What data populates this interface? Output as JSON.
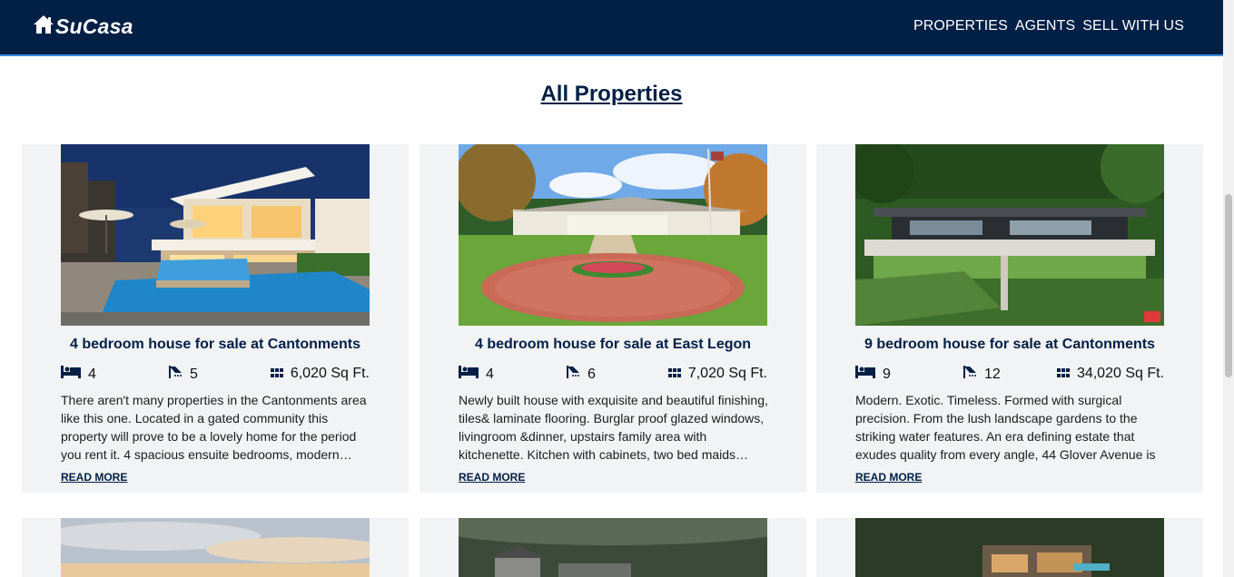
{
  "brand": {
    "name": "SuCasa",
    "icon": "house-icon"
  },
  "nav": {
    "items": [
      {
        "label": "PROPERTIES"
      },
      {
        "label": "AGENTS"
      },
      {
        "label": "SELL WITH US"
      }
    ]
  },
  "main": {
    "title": "All Properties",
    "cards": [
      {
        "title": "4 bedroom house for sale at Cantonments",
        "beds": "4",
        "baths": "5",
        "area": "6,020 Sq Ft.",
        "description": "There aren't many properties in the Cantonments area like this one. Located in a gated community this property will prove to be a lovely home for the period you rent it. 4 spacious ensuite bedrooms, modern…",
        "read_more": "READ MORE",
        "image": "modern-villa-pool-photo"
      },
      {
        "title": "4 bedroom house for sale at East Legon",
        "beds": "4",
        "baths": "6",
        "area": "7,020 Sq Ft.",
        "description": "Newly built house with exquisite and beautiful finishing, tiles& laminate flooring. Burglar proof glazed windows, livingroom &dinner, upstairs family area with kitchenette. Kitchen with cabinets, two bed maids…",
        "read_more": "READ MORE",
        "image": "ranch-house-lawn-photo"
      },
      {
        "title": "9 bedroom house for sale at Cantonments",
        "beds": "9",
        "baths": "12",
        "area": "34,020 Sq Ft.",
        "description": "Modern. Exotic. Timeless. Formed with surgical precision. From the lush landscape gardens to the striking water features. An era defining estate that exudes quality from every angle, 44 Glover Avenue is …",
        "read_more": "READ MORE",
        "image": "hillside-estate-photo"
      }
    ]
  },
  "icons": {
    "beds": "bed-icon",
    "baths": "shower-icon",
    "area": "grid-icon"
  },
  "colors": {
    "navy": "#021f45",
    "accent": "#3d8fe0",
    "card_bg": "#f2f3f5"
  }
}
